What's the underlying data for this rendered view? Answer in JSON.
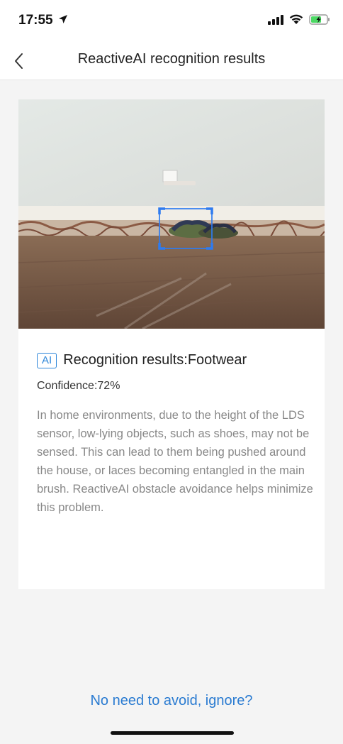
{
  "status": {
    "time": "17:55"
  },
  "nav": {
    "title": "ReactiveAI recognition results"
  },
  "result": {
    "ai_badge": "AI",
    "title": "Recognition results:Footwear",
    "confidence": "Confidence:72%",
    "description": "In home environments, due to the height of the LDS sensor, low-lying objects, such as shoes, may not be sensed. This can lead to them being pushed around the house, or laces becoming entangled in the main brush. ReactiveAI obstacle avoidance helps minimize this problem."
  },
  "actions": {
    "ignore_label": "No need to avoid, ignore?"
  },
  "colors": {
    "accent": "#2a7bd1",
    "battery": "#4cd964"
  }
}
